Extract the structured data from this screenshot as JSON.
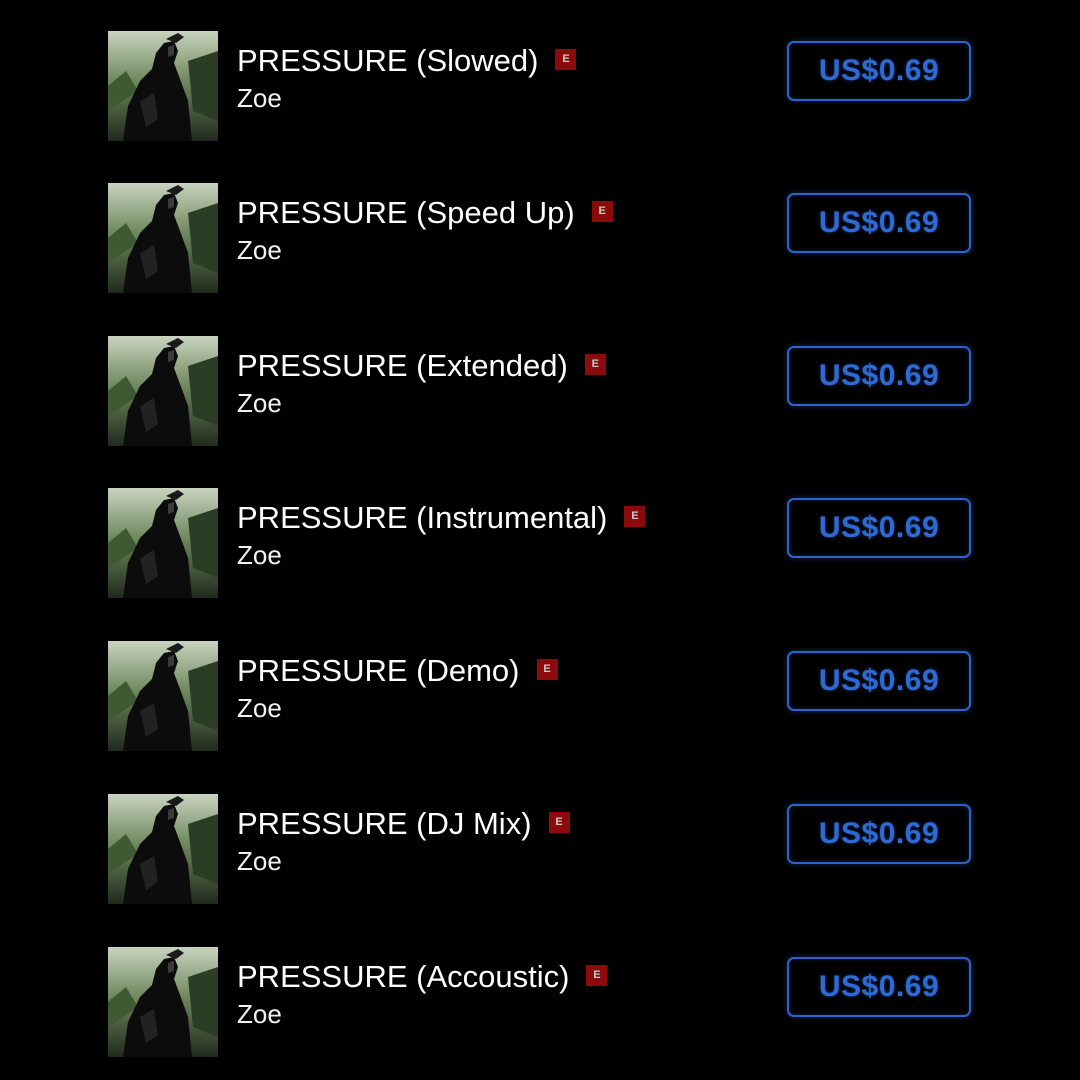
{
  "colors": {
    "background": "#000000",
    "title": "#ffffff",
    "explicit_badge": "#8b0a0a",
    "price_accent": "#2e6ad3"
  },
  "tracks": [
    {
      "title": "PRESSURE (Slowed)",
      "explicit": "E",
      "artist": "Zoe",
      "price": "US$0.69"
    },
    {
      "title": "PRESSURE (Speed Up)",
      "explicit": "E",
      "artist": "Zoe",
      "price": "US$0.69"
    },
    {
      "title": "PRESSURE (Extended)",
      "explicit": "E",
      "artist": "Zoe",
      "price": "US$0.69"
    },
    {
      "title": "PRESSURE (Instrumental)",
      "explicit": "E",
      "artist": "Zoe",
      "price": "US$0.69"
    },
    {
      "title": "PRESSURE (Demo)",
      "explicit": "E",
      "artist": "Zoe",
      "price": "US$0.69"
    },
    {
      "title": "PRESSURE (DJ Mix)",
      "explicit": "E",
      "artist": "Zoe",
      "price": "US$0.69"
    },
    {
      "title": "PRESSURE (Accoustic)",
      "explicit": "E",
      "artist": "Zoe",
      "price": "US$0.69"
    }
  ]
}
